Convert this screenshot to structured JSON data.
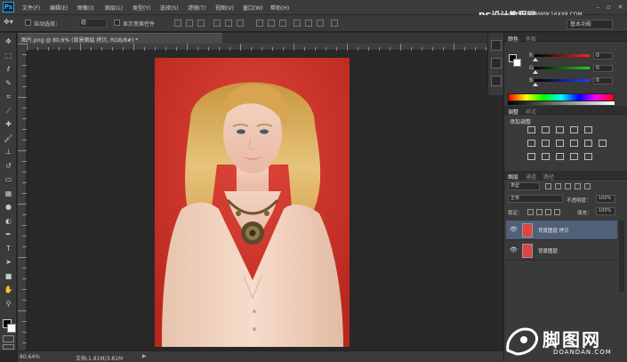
{
  "app": {
    "logo": "Ps"
  },
  "menu": [
    "文件(F)",
    "编辑(E)",
    "图像(I)",
    "图层(L)",
    "类型(Y)",
    "选择(S)",
    "滤镜(T)",
    "视图(V)",
    "窗口(W)",
    "帮助(H)"
  ],
  "window_controls": {
    "minimize": "–",
    "restore": "▫",
    "close": "✕"
  },
  "watermark_top": {
    "title": "PS设计教程网",
    "url": "WWW.16XX8.COM"
  },
  "options": {
    "auto_select_label": "自动选择：",
    "auto_select_value": "组",
    "show_transform_label": "显示变换控件",
    "workspace": "基本功能"
  },
  "document": {
    "tab_label": "图片.png @ 80.6% (背景图层 拷贝, RGB/8#) *",
    "zoom": "80.64%",
    "doc_info": "文档:1.81M/3.81M"
  },
  "panels": {
    "color": {
      "tabs": [
        "颜色",
        "色板"
      ],
      "channels": [
        {
          "label": "R",
          "value": "0",
          "color": "#ff3030"
        },
        {
          "label": "G",
          "value": "0",
          "color": "#30d030"
        },
        {
          "label": "B",
          "value": "0",
          "color": "#3050ff"
        }
      ]
    },
    "adjustments": {
      "tabs": [
        "调整",
        "样式"
      ],
      "title": "添加调整"
    },
    "layers": {
      "tabs": [
        "图层",
        "通道",
        "路径"
      ],
      "filter": "类型",
      "blend_mode": "正常",
      "opacity_label": "不透明度：",
      "opacity_value": "100%",
      "lock_label": "锁定：",
      "fill_label": "填充：",
      "fill_value": "100%",
      "items": [
        {
          "name": "背景图层 拷贝",
          "selected": true
        },
        {
          "name": "背景图层",
          "selected": false
        }
      ]
    }
  },
  "watermark_bottom": {
    "title": "脚图网",
    "url": "DOANDAN.COM"
  },
  "icons": {
    "tools": [
      "move-tool-icon",
      "marquee-tool-icon",
      "lasso-tool-icon",
      "quick-select-tool-icon",
      "crop-tool-icon",
      "eyedropper-tool-icon",
      "healing-brush-icon",
      "brush-tool-icon",
      "clone-stamp-icon",
      "history-brush-icon",
      "eraser-tool-icon",
      "gradient-tool-icon",
      "blur-tool-icon",
      "dodge-tool-icon",
      "pen-tool-icon",
      "type-tool-icon",
      "path-select-icon",
      "shape-tool-icon",
      "hand-tool-icon",
      "zoom-tool-icon"
    ]
  },
  "colors": {
    "accent": "#35b0ff",
    "selected_layer": "#506079",
    "canvas_bg": "#282828"
  }
}
